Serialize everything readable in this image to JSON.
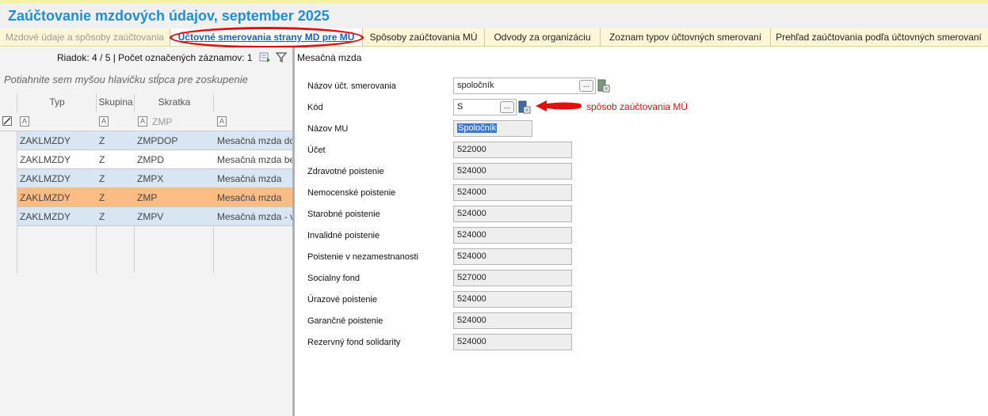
{
  "window": {
    "title": "Zaúčtovanie mzdových údajov, september 2025"
  },
  "tabs": [
    {
      "label": "Mzdové údaje a spôsoby zaúčtovania",
      "state": "disabled"
    },
    {
      "label": "Účtovné smerovania strany MD pre MÚ",
      "state": "active"
    },
    {
      "label": "Spôsoby zaúčtovania MÚ",
      "state": "normal"
    },
    {
      "label": "Odvody za organizáciu",
      "state": "normal"
    },
    {
      "label": "Zoznam typov účtovných smerovaní",
      "state": "normal"
    },
    {
      "label": "Prehľad zaúčtovania podľa účtovných smerovaní",
      "state": "normal"
    }
  ],
  "left": {
    "status": "Riadok: 4 / 5 | Počet označených záznamov: 1",
    "group_hint": "Potiahnite sem myšou hlavičku stĺpca pre zoskupenie",
    "columns": [
      "Typ",
      "Skupina",
      "Skratka",
      ""
    ],
    "filter_skratka": "ZMP",
    "rows": [
      {
        "typ": "ZAKLMZDY",
        "skupina": "Z",
        "skratka": "ZMPDOP",
        "nazov": "Mesačná mzda do"
      },
      {
        "typ": "ZAKLMZDY",
        "skupina": "Z",
        "skratka": "ZMPD",
        "nazov": "Mesačná mzda be"
      },
      {
        "typ": "ZAKLMZDY",
        "skupina": "Z",
        "skratka": "ZMPX",
        "nazov": "Mesačná mzda"
      },
      {
        "typ": "ZAKLMZDY",
        "skupina": "Z",
        "skratka": "ZMP",
        "nazov": "Mesačná mzda"
      },
      {
        "typ": "ZAKLMZDY",
        "skupina": "Z",
        "skratka": "ZMPV",
        "nazov": "Mesačná mzda - v"
      }
    ],
    "selected_row": 3
  },
  "right": {
    "section_title": "Mesačná mzda",
    "fields": {
      "nazov_uct_smerovania": {
        "label": "Názov účt. smerovania",
        "value": "spoločník"
      },
      "kod": {
        "label": "Kód",
        "value": "S"
      },
      "nazov_mu": {
        "label": "Názov MU",
        "value": "Spoločník"
      },
      "ucet": {
        "label": "Účet",
        "value": "522000"
      },
      "zdravotne": {
        "label": "Zdravotné poistenie",
        "value": "524000"
      },
      "nemocenske": {
        "label": "Nemocenské poistenie",
        "value": "524000"
      },
      "starobne": {
        "label": "Starobné poistenie",
        "value": "524000"
      },
      "invalidne": {
        "label": "Invalidné poistenie",
        "value": "524000"
      },
      "nezamestnanost": {
        "label": "Poistenie v nezamestnanosti",
        "value": "524000"
      },
      "socialny_fond": {
        "label": "Socialny fond",
        "value": "527000"
      },
      "urazove": {
        "label": "Úrazové poistenie",
        "value": "524000"
      },
      "garancne": {
        "label": "Garančné poistenie",
        "value": "524000"
      },
      "rezervny": {
        "label": "Rezervný fond solidarity",
        "value": "524000"
      }
    },
    "annotation": "spôsob zaúčtovania MÚ",
    "ellipsis": "..."
  },
  "colors": {
    "accent": "#1e8fd6",
    "selected_row": "#fcbd85",
    "alt_row": "#d8e6f3",
    "annotation": "#e01010"
  }
}
